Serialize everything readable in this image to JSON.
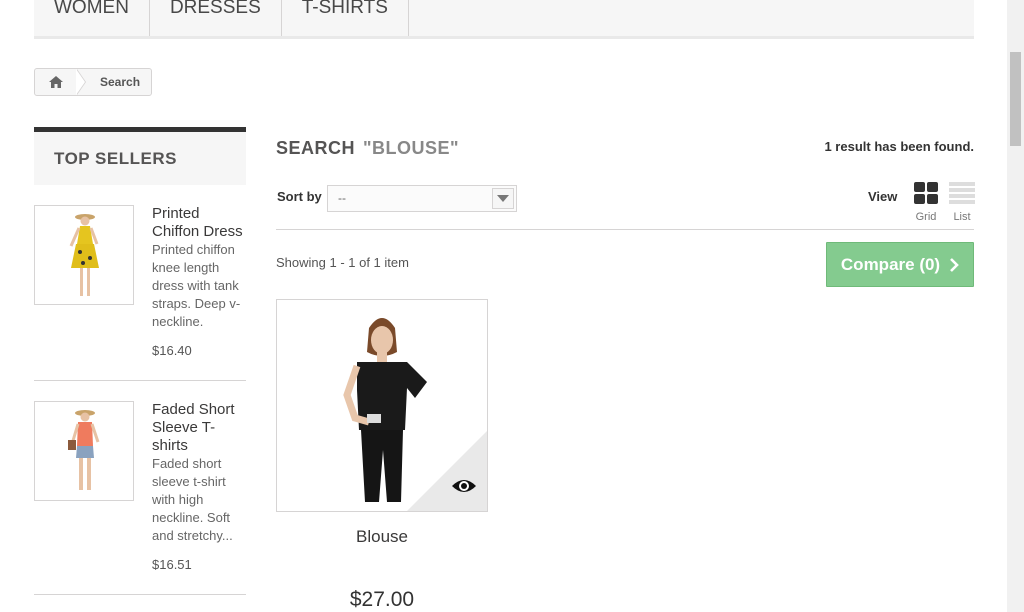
{
  "topnav": {
    "items": [
      {
        "label": "WOMEN"
      },
      {
        "label": "DRESSES"
      },
      {
        "label": "T-SHIRTS"
      }
    ]
  },
  "breadcrumb": {
    "home_icon": "home-icon",
    "current": "Search"
  },
  "sidebar": {
    "title": "TOP SELLERS",
    "items": [
      {
        "name": "Printed Chiffon Dress",
        "description": "Printed chiffon knee length dress with tank straps. Deep v-neckline.",
        "price": "$16.40"
      },
      {
        "name": "Faded Short Sleeve T-shirts",
        "description": "Faded short sleeve t-shirt with high neckline. Soft and stretchy...",
        "price": "$16.51"
      }
    ]
  },
  "search": {
    "heading": "SEARCH",
    "term": "\"BLOUSE\"",
    "result_count": "1 result has been found."
  },
  "sort": {
    "label": "Sort by",
    "selected": "--"
  },
  "view": {
    "label": "View",
    "grid_label": "Grid",
    "list_label": "List"
  },
  "listing": {
    "showing": "Showing 1 - 1 of 1 item",
    "compare_label": "Compare (0)"
  },
  "product": {
    "name": "Blouse",
    "price": "$27.00"
  },
  "colors": {
    "compare_green": "#84cb8f",
    "dark": "#333333"
  }
}
